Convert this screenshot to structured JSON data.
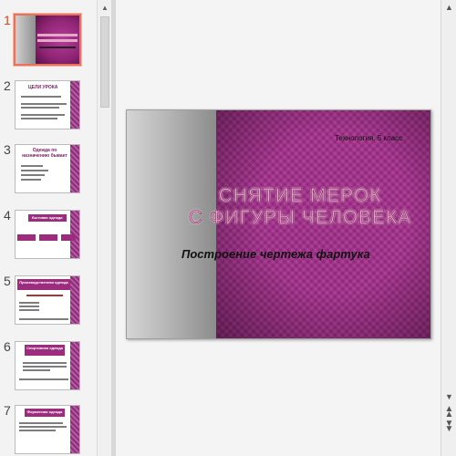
{
  "thumbnails": [
    {
      "number": "1"
    },
    {
      "number": "2",
      "title": "ЦЕЛИ УРОКА"
    },
    {
      "number": "3",
      "title": "Одежда по назначению бывает"
    },
    {
      "number": "4",
      "title": "Бытовая одежда"
    },
    {
      "number": "5",
      "title": "Производственная одежда"
    },
    {
      "number": "6",
      "title": "Спортивная одежда"
    },
    {
      "number": "7",
      "title": "Форменная одежда"
    }
  ],
  "slide": {
    "top_subtitle": "Технология. 5 класс",
    "title_line1": "СНЯТИЕ МЕРОК",
    "title_line2": "С ФИГУРЫ ЧЕЛОВЕКА",
    "subtitle": "Построение чертежа фартука"
  },
  "icons": {
    "scroll_up": "up-arrow-icon",
    "scroll_down": "down-arrow-icon",
    "prev_slide": "double-up-arrow-icon",
    "next_slide": "double-down-arrow-icon"
  },
  "colors": {
    "accent_selected": "#e8735a",
    "slide_purple": "#a22d8a"
  }
}
